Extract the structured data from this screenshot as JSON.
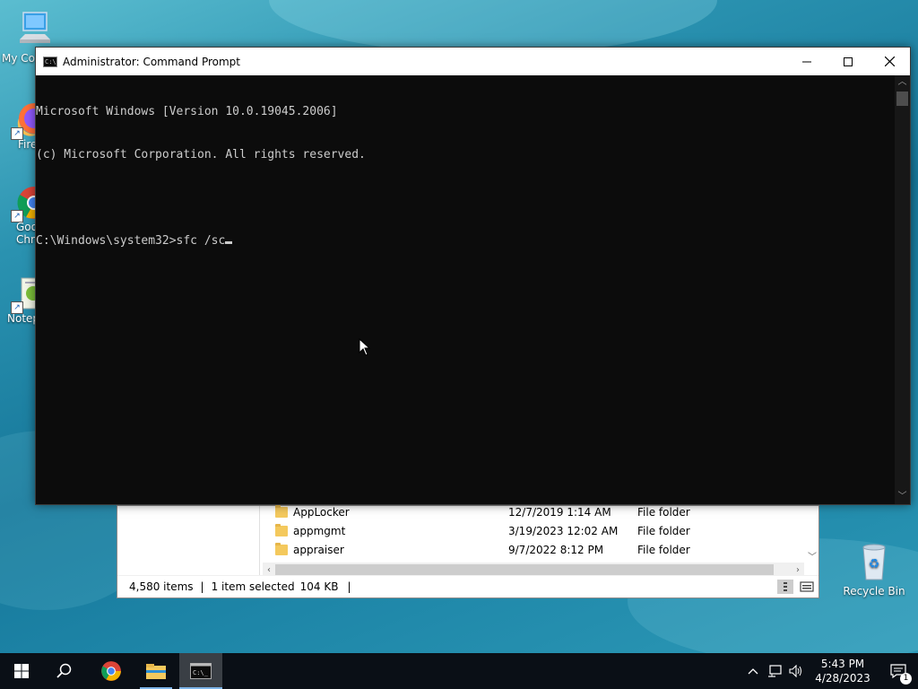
{
  "desktop": {
    "icons": [
      {
        "label": "My Co",
        "icon": "computer-icon"
      },
      {
        "label": "Fire",
        "icon": "firefox-icon"
      },
      {
        "label": "Goo\nChro",
        "icon": "chrome-icon"
      },
      {
        "label": "Notep",
        "icon": "notepad-icon"
      }
    ],
    "recycle_bin": {
      "label": "Recycle Bin",
      "icon": "recycle-bin-icon"
    }
  },
  "cmd": {
    "title": "Administrator: Command Prompt",
    "lines": [
      "Microsoft Windows [Version 10.0.19045.2006]",
      "(c) Microsoft Corporation. All rights reserved.",
      "",
      "C:\\Windows\\system32>sfc /sc"
    ],
    "buttons": {
      "minimize": "minimize-icon",
      "maximize": "maximize-icon",
      "close": "close-icon"
    }
  },
  "explorer": {
    "rows": [
      {
        "name": "AppLocker",
        "date": "12/7/2019 1:14 AM",
        "type": "File folder"
      },
      {
        "name": "appmgmt",
        "date": "3/19/2023 12:02 AM",
        "type": "File folder"
      },
      {
        "name": "appraiser",
        "date": "9/7/2022 8:12 PM",
        "type": "File folder"
      }
    ],
    "status": {
      "items": "4,580 items",
      "selected": "1 item selected",
      "size": "104 KB",
      "sep": "|"
    }
  },
  "taskbar": {
    "time": "5:43 PM",
    "date": "4/28/2023",
    "notification_count": "1",
    "colors": {
      "background": "#0a0f16",
      "accent": "#7db4e8"
    }
  }
}
